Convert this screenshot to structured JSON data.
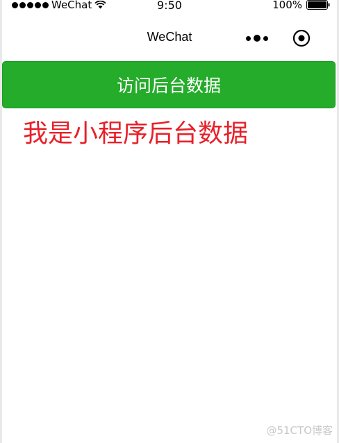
{
  "status_bar": {
    "carrier": "WeChat",
    "time": "9:50",
    "battery_percent": "100%",
    "signal_icon": "signal-dots-icon",
    "wifi_icon": "wifi-icon",
    "battery_icon": "battery-icon"
  },
  "nav": {
    "title": "WeChat",
    "more_icon": "more-icon",
    "close_icon": "close-circle-icon"
  },
  "main": {
    "button_label": "访问后台数据",
    "result_text": "我是小程序后台数据"
  },
  "watermark": {
    "text": "@51CTO博客"
  },
  "colors": {
    "button_bg": "#24ac2a",
    "result_text": "#e8202a",
    "background": "#ffffff"
  }
}
